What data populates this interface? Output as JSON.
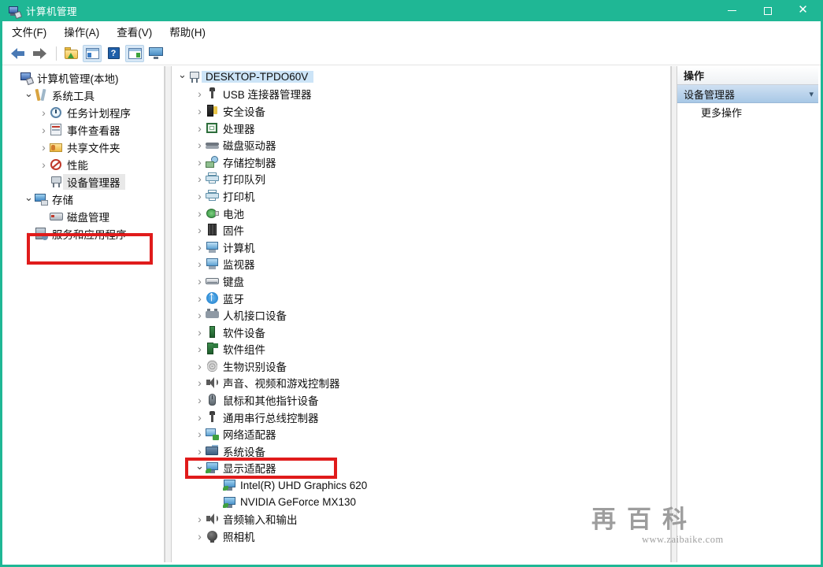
{
  "window": {
    "title": "计算机管理",
    "accent_color": "#1fb795",
    "controls": {
      "minimize": "minimize-icon",
      "maximize": "maximize-icon",
      "close": "close-icon"
    }
  },
  "menubar": {
    "items": [
      {
        "label": "文件(F)",
        "name": "menu-file"
      },
      {
        "label": "操作(A)",
        "name": "menu-action"
      },
      {
        "label": "查看(V)",
        "name": "menu-view"
      },
      {
        "label": "帮助(H)",
        "name": "menu-help"
      }
    ]
  },
  "toolbar": {
    "items": [
      {
        "name": "back-arrow-icon"
      },
      {
        "name": "forward-arrow-icon"
      },
      {
        "name": "folder-up-icon"
      },
      {
        "name": "show-hide-console-tree-icon"
      },
      {
        "name": "help-icon",
        "glyph": "?"
      },
      {
        "name": "show-hide-action-pane-icon"
      },
      {
        "name": "display-properties-icon"
      }
    ]
  },
  "tree": {
    "items": [
      {
        "label": "计算机管理(本地)",
        "indent": 0,
        "chev": "none",
        "icon": "computer-management-icon",
        "selected": false
      },
      {
        "label": "系统工具",
        "indent": 1,
        "chev": "open",
        "icon": "system-tools-icon",
        "selected": false
      },
      {
        "label": "任务计划程序",
        "indent": 2,
        "chev": "closed",
        "icon": "task-scheduler-icon",
        "selected": false
      },
      {
        "label": "事件查看器",
        "indent": 2,
        "chev": "closed",
        "icon": "event-viewer-icon",
        "selected": false
      },
      {
        "label": "共享文件夹",
        "indent": 2,
        "chev": "closed",
        "icon": "shared-folders-icon",
        "selected": false
      },
      {
        "label": "性能",
        "indent": 2,
        "chev": "closed",
        "icon": "performance-icon",
        "selected": false
      },
      {
        "label": "设备管理器",
        "indent": 2,
        "chev": "none",
        "icon": "device-manager-icon",
        "selected": true
      },
      {
        "label": "存储",
        "indent": 1,
        "chev": "open",
        "icon": "storage-icon",
        "selected": false
      },
      {
        "label": "磁盘管理",
        "indent": 2,
        "chev": "none",
        "icon": "disk-management-icon",
        "selected": false
      },
      {
        "label": "服务和应用程序",
        "indent": 1,
        "chev": "closed",
        "icon": "services-and-apps-icon",
        "selected": false
      }
    ]
  },
  "device_list": {
    "items": [
      {
        "label": "DESKTOP-TPDO60V",
        "indent": 0,
        "chev": "open",
        "icon": "computer-root-icon",
        "selected": true
      },
      {
        "label": "USB 连接器管理器",
        "indent": 1,
        "chev": "closed",
        "icon": "usb-icon",
        "selected": false
      },
      {
        "label": "安全设备",
        "indent": 1,
        "chev": "closed",
        "icon": "security-device-icon",
        "selected": false
      },
      {
        "label": "处理器",
        "indent": 1,
        "chev": "closed",
        "icon": "processor-icon",
        "selected": false
      },
      {
        "label": "磁盘驱动器",
        "indent": 1,
        "chev": "closed",
        "icon": "disk-drive-icon",
        "selected": false
      },
      {
        "label": "存储控制器",
        "indent": 1,
        "chev": "closed",
        "icon": "storage-controller-icon",
        "selected": false
      },
      {
        "label": "打印队列",
        "indent": 1,
        "chev": "closed",
        "icon": "print-queue-icon",
        "selected": false
      },
      {
        "label": "打印机",
        "indent": 1,
        "chev": "closed",
        "icon": "printer-icon",
        "selected": false
      },
      {
        "label": "电池",
        "indent": 1,
        "chev": "closed",
        "icon": "battery-icon",
        "selected": false
      },
      {
        "label": "固件",
        "indent": 1,
        "chev": "closed",
        "icon": "firmware-icon",
        "selected": false
      },
      {
        "label": "计算机",
        "indent": 1,
        "chev": "closed",
        "icon": "computer-icon",
        "selected": false
      },
      {
        "label": "监视器",
        "indent": 1,
        "chev": "closed",
        "icon": "monitor-icon",
        "selected": false
      },
      {
        "label": "键盘",
        "indent": 1,
        "chev": "closed",
        "icon": "keyboard-icon",
        "selected": false
      },
      {
        "label": "蓝牙",
        "indent": 1,
        "chev": "closed",
        "icon": "bluetooth-icon",
        "selected": false
      },
      {
        "label": "人机接口设备",
        "indent": 1,
        "chev": "closed",
        "icon": "hid-icon",
        "selected": false
      },
      {
        "label": "软件设备",
        "indent": 1,
        "chev": "closed",
        "icon": "software-device-icon",
        "selected": false
      },
      {
        "label": "软件组件",
        "indent": 1,
        "chev": "closed",
        "icon": "software-component-icon",
        "selected": false
      },
      {
        "label": "生物识别设备",
        "indent": 1,
        "chev": "closed",
        "icon": "biometric-device-icon",
        "selected": false
      },
      {
        "label": "声音、视频和游戏控制器",
        "indent": 1,
        "chev": "closed",
        "icon": "sound-video-game-icon",
        "selected": false
      },
      {
        "label": "鼠标和其他指针设备",
        "indent": 1,
        "chev": "closed",
        "icon": "mouse-icon",
        "selected": false
      },
      {
        "label": "通用串行总线控制器",
        "indent": 1,
        "chev": "closed",
        "icon": "usb-controller-icon",
        "selected": false
      },
      {
        "label": "网络适配器",
        "indent": 1,
        "chev": "closed",
        "icon": "network-adapter-icon",
        "selected": false
      },
      {
        "label": "系统设备",
        "indent": 1,
        "chev": "closed",
        "icon": "system-device-icon",
        "selected": false
      },
      {
        "label": "显示适配器",
        "indent": 1,
        "chev": "open",
        "icon": "display-adapter-icon",
        "selected": false
      },
      {
        "label": "Intel(R) UHD Graphics 620",
        "indent": 2,
        "chev": "none",
        "icon": "display-adapter-child-icon",
        "selected": false
      },
      {
        "label": "NVIDIA GeForce MX130",
        "indent": 2,
        "chev": "none",
        "icon": "display-adapter-child-icon",
        "selected": false
      },
      {
        "label": "音频输入和输出",
        "indent": 1,
        "chev": "closed",
        "icon": "audio-io-icon",
        "selected": false
      },
      {
        "label": "照相机",
        "indent": 1,
        "chev": "closed",
        "icon": "camera-icon",
        "selected": false
      }
    ]
  },
  "actions_pane": {
    "header": "操作",
    "title": "设备管理器",
    "more_label": "更多操作"
  },
  "annotations": {
    "highlight_color": "#e01b1b",
    "boxes": [
      {
        "name": "device-manager-highlight",
        "target": "设备管理器"
      },
      {
        "name": "display-adapter-highlight",
        "target": "显示适配器"
      }
    ]
  },
  "watermark": {
    "char1": "再",
    "char2": "百",
    "char3": "科",
    "url": "www.zaibaike.com"
  }
}
